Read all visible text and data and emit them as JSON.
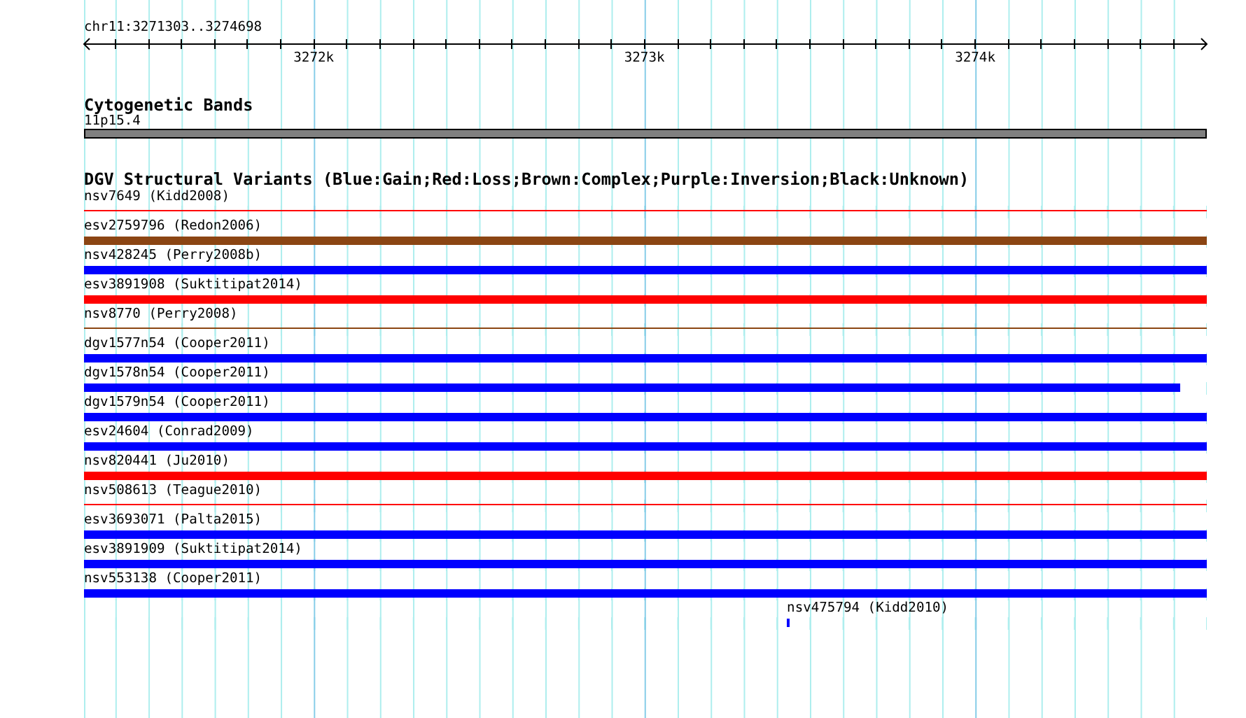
{
  "ruler": {
    "range": "chr11:3271303..3274698",
    "labels": [
      "3272k",
      "3273k",
      "3274k"
    ]
  },
  "cytogenetic_bands": {
    "title": "Cytogenetic Bands",
    "band": "11p15.4"
  },
  "dgv_track": {
    "title": "DGV Structural Variants (Blue:Gain;Red:Loss;Brown:Complex;Purple:Inversion;Black:Unknown)",
    "variants": [
      {
        "label": "nsv7649 (Kidd2008)",
        "kind": "line",
        "color": "#ff0000",
        "level": 1
      },
      {
        "label": "esv2759796 (Redon2006)",
        "kind": "bar",
        "color": "#8b4513",
        "level": 1
      },
      {
        "label": "nsv428245 (Perry2008b)",
        "kind": "bar",
        "color": "#0000ff",
        "level": 1
      },
      {
        "label": "esv3891908 (Suktitipat2014)",
        "kind": "bar",
        "color": "#ff0000",
        "level": 1
      },
      {
        "label": "nsv8770 (Perry2008)",
        "kind": "line",
        "color": "#8b4513",
        "level": 1
      },
      {
        "label": "dgv1577n54 (Cooper2011)",
        "kind": "bar",
        "color": "#0000ff",
        "level": 1
      },
      {
        "label": "dgv1578n54 (Cooper2011)",
        "kind": "bar",
        "color": "#0000ff",
        "level": 0.976
      },
      {
        "label": "dgv1579n54 (Cooper2011)",
        "kind": "bar",
        "color": "#0000ff",
        "level": 1
      },
      {
        "label": "esv24604 (Conrad2009)",
        "kind": "bar",
        "color": "#0000ff",
        "level": 1
      },
      {
        "label": "nsv820441 (Ju2010)",
        "kind": "bar",
        "color": "#ff0000",
        "level": 1
      },
      {
        "label": "nsv508613 (Teague2010)",
        "kind": "line",
        "color": "#ff0000",
        "level": 1
      },
      {
        "label": "esv3693071 (Palta2015)",
        "kind": "bar",
        "color": "#0000ff",
        "level": 1
      },
      {
        "label": "esv3891909 (Suktitipat2014)",
        "kind": "bar",
        "color": "#0000ff",
        "level": 1
      },
      {
        "label": "nsv553138 (Cooper2011)",
        "kind": "bar",
        "color": "#0000ff",
        "level": 1
      },
      {
        "label": "nsv475794 (Kidd2010)",
        "kind": "point",
        "color": "#0000ff",
        "level": 0.626
      }
    ]
  }
}
